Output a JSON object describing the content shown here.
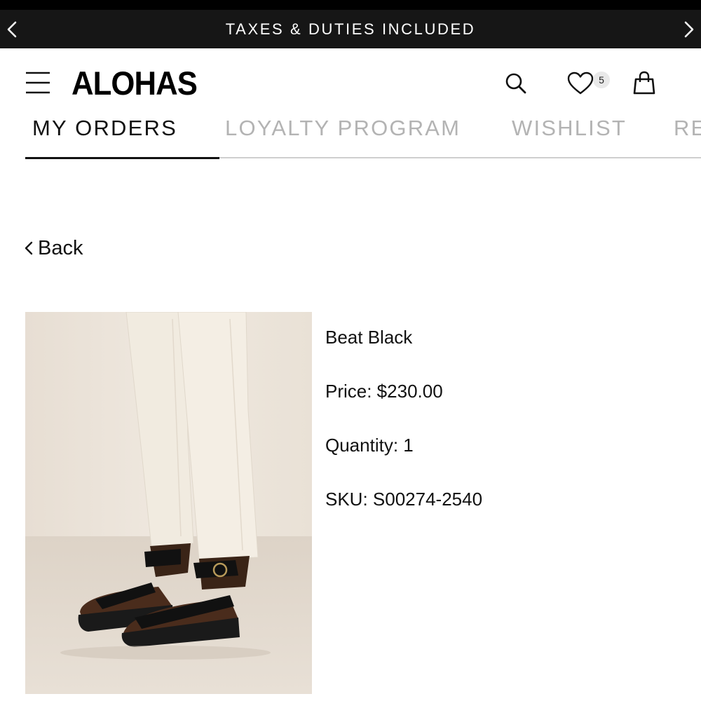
{
  "banner": {
    "text": "TAXES & DUTIES INCLUDED",
    "prev_icon": "chevron-left-icon",
    "next_icon": "chevron-right-icon"
  },
  "header": {
    "logo": "ALOHAS",
    "menu_icon": "hamburger-menu-icon",
    "search_icon": "search-icon",
    "wishlist_icon": "heart-icon",
    "wishlist_count": "5",
    "bag_icon": "shopping-bag-icon"
  },
  "tabs": [
    {
      "label": "MY ORDERS",
      "active": true
    },
    {
      "label": "LOYALTY PROGRAM",
      "active": false
    },
    {
      "label": "WISHLIST",
      "active": false
    },
    {
      "label": "RE",
      "active": false
    }
  ],
  "back": {
    "label": "Back",
    "icon": "chevron-left-icon"
  },
  "product": {
    "image": "product-photo",
    "name": "Beat Black",
    "price": "Price: $230.00",
    "quantity": "Quantity: 1",
    "sku": "SKU: S00274-2540"
  },
  "colors": {
    "banner_bg": "#161616",
    "text": "#111111",
    "inactive_tab": "#b3b3b3",
    "badge_bg": "#e9e9e9"
  }
}
